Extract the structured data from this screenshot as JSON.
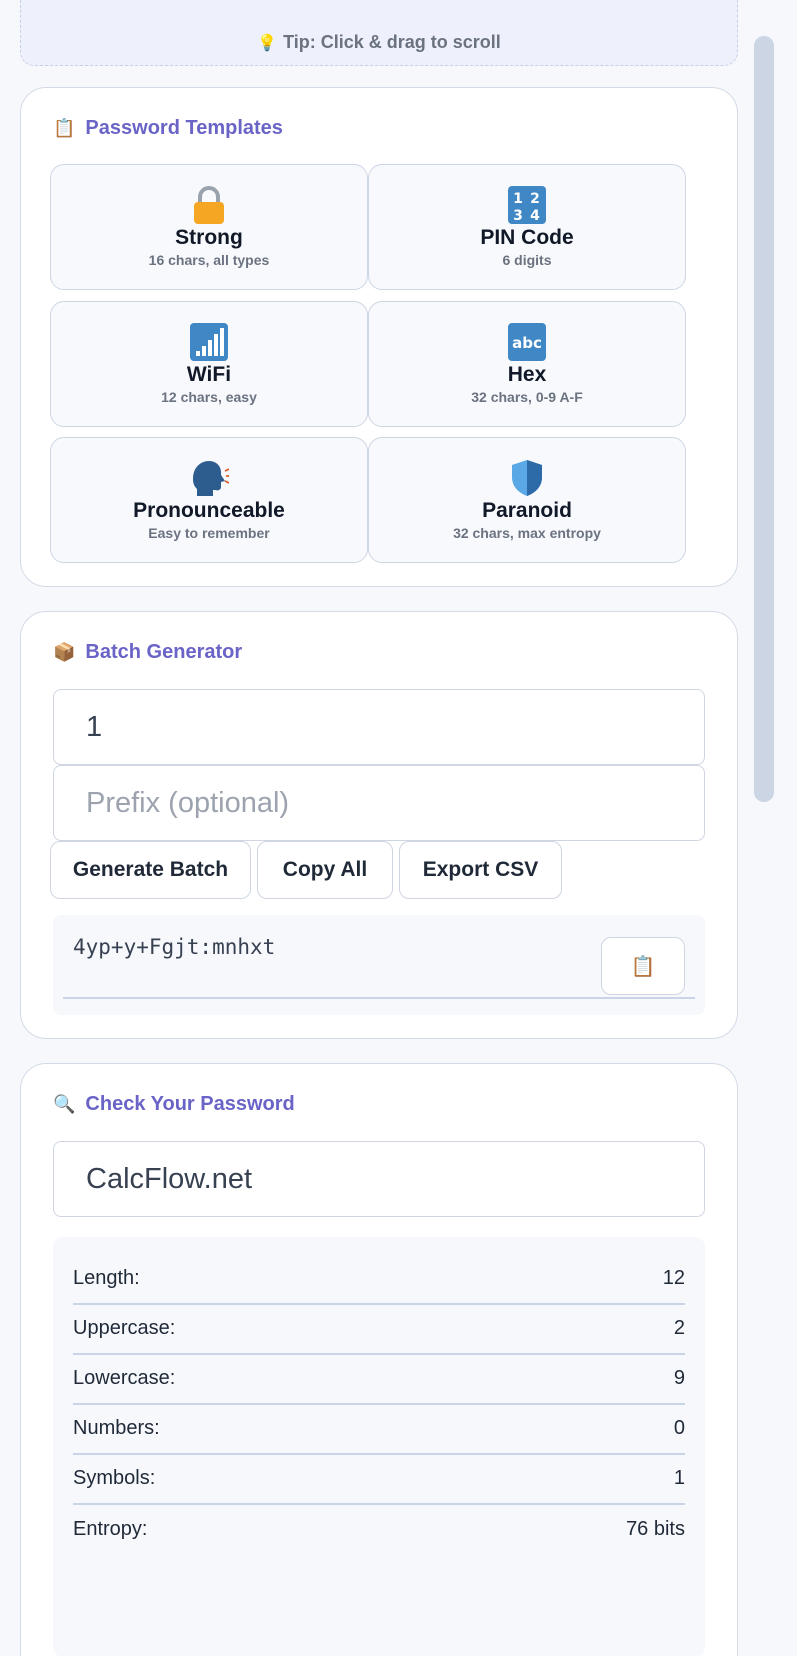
{
  "tip": {
    "icon": "lightbulb-icon",
    "text": "Tip: Click & drag to scroll"
  },
  "templates": {
    "title": "Password Templates",
    "title_icon": "clipboard-icon",
    "items": [
      {
        "name": "Strong",
        "desc": "16 chars, all types",
        "icon": "lock-icon"
      },
      {
        "name": "PIN Code",
        "desc": "6 digits",
        "icon": "numbers-icon"
      },
      {
        "name": "WiFi",
        "desc": "12 chars, easy",
        "icon": "signal-bars-icon"
      },
      {
        "name": "Hex",
        "desc": "32 chars, 0-9 A-F",
        "icon": "abc-icon"
      },
      {
        "name": "Pronounceable",
        "desc": "Easy to remember",
        "icon": "speaking-head-icon"
      },
      {
        "name": "Paranoid",
        "desc": "32 chars, max entropy",
        "icon": "shield-icon"
      }
    ]
  },
  "batch": {
    "title": "Batch Generator",
    "title_icon": "package-icon",
    "count_value": "1",
    "prefix_placeholder": "Prefix (optional)",
    "generate_label": "Generate Batch",
    "copy_all_label": "Copy All",
    "export_label": "Export CSV",
    "result": "4yp+y+Fgjt:mnhxt",
    "copy_icon": "clipboard-icon"
  },
  "check": {
    "title": "Check Your Password",
    "title_icon": "magnifier-icon",
    "input_value": "CalcFlow.net",
    "stats": [
      {
        "label": "Length:",
        "value": "12"
      },
      {
        "label": "Uppercase:",
        "value": "2"
      },
      {
        "label": "Lowercase:",
        "value": "9"
      },
      {
        "label": "Numbers:",
        "value": "0"
      },
      {
        "label": "Symbols:",
        "value": "1"
      },
      {
        "label": "Entropy:",
        "value": "76 bits"
      }
    ]
  }
}
